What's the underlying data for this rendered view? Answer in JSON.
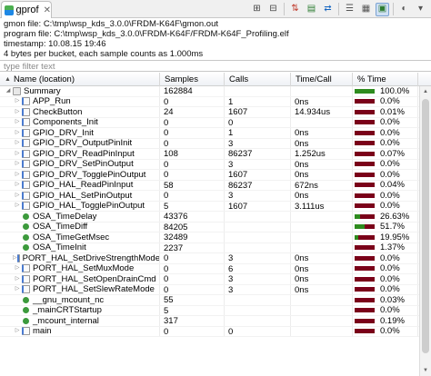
{
  "view_tab": {
    "label": "gprof",
    "close": "✕"
  },
  "toolbar": [
    {
      "name": "expand-all-icon",
      "glyph": "⊞",
      "color": "#444444",
      "active": false
    },
    {
      "name": "collapse-all-icon",
      "glyph": "⊟",
      "color": "#444444",
      "active": false
    },
    {
      "name": "sort-icon",
      "glyph": "⇅",
      "color": "#c0392b",
      "active": false
    },
    {
      "name": "export-csv-icon",
      "glyph": "▤",
      "color": "#2e7d32",
      "active": false
    },
    {
      "name": "switch-sample-time-icon",
      "glyph": "⇄",
      "color": "#1565c0",
      "active": false
    },
    {
      "name": "flat-view-icon",
      "glyph": "☰",
      "color": "#555555",
      "active": false
    },
    {
      "name": "tree-view-icon",
      "glyph": "▦",
      "color": "#555555",
      "active": false
    },
    {
      "name": "function-view-icon",
      "glyph": "▣",
      "color": "#2e7d32",
      "active": true
    },
    {
      "name": "chart-icon",
      "glyph": "◐",
      "color": "#555555",
      "active": false
    },
    {
      "name": "view-menu-icon",
      "glyph": "▾",
      "color": "#555555",
      "active": false
    }
  ],
  "info": {
    "gmon_file": "gmon file: C:\\tmp\\wsp_kds_3.0.0\\FRDM-K64F\\gmon.out",
    "program_file": "program file: C:\\tmp\\wsp_kds_3.0.0\\FRDM-K64F/FRDM-K64F_Profiling.elf",
    "timestamp": "timestamp: 10.08.15 19:46",
    "bucket_info": "4 bytes per bucket, each sample counts as 1.000ms"
  },
  "filter": {
    "placeholder": "type filter text",
    "value": ""
  },
  "columns": {
    "name": "Name (location)",
    "samples": "Samples",
    "calls": "Calls",
    "time_call": "Time/Call",
    "pct_time": "% Time"
  },
  "sort_indicator": "▲",
  "colors": {
    "bar_good": "#2e8b1e",
    "bar_bad": "#7a0019"
  },
  "rows": [
    {
      "level": 0,
      "kind": "summary",
      "expand": "◢",
      "name": "Summary",
      "samples": "162884",
      "calls": "",
      "time_call": "",
      "pct": "100.0%",
      "fill": 1.0
    },
    {
      "level": 1,
      "kind": "file",
      "expand": "▷",
      "name": "APP_Run",
      "samples": "0",
      "calls": "1",
      "time_call": "0ns",
      "pct": "0.0%",
      "fill": 0.0
    },
    {
      "level": 1,
      "kind": "file",
      "expand": "▷",
      "name": "CheckButton",
      "samples": "24",
      "calls": "1607",
      "time_call": "14.934us",
      "pct": "0.01%",
      "fill": 0.0
    },
    {
      "level": 1,
      "kind": "file",
      "expand": "▷",
      "name": "Components_Init",
      "samples": "0",
      "calls": "0",
      "time_call": "",
      "pct": "0.0%",
      "fill": 0.0
    },
    {
      "level": 1,
      "kind": "file",
      "expand": "▷",
      "name": "GPIO_DRV_Init",
      "samples": "0",
      "calls": "1",
      "time_call": "0ns",
      "pct": "0.0%",
      "fill": 0.0
    },
    {
      "level": 1,
      "kind": "file",
      "expand": "▷",
      "name": "GPIO_DRV_OutputPinInit",
      "samples": "0",
      "calls": "3",
      "time_call": "0ns",
      "pct": "0.0%",
      "fill": 0.0
    },
    {
      "level": 1,
      "kind": "file",
      "expand": "▷",
      "name": "GPIO_DRV_ReadPinInput",
      "samples": "108",
      "calls": "86237",
      "time_call": "1.252us",
      "pct": "0.07%",
      "fill": 0.0
    },
    {
      "level": 1,
      "kind": "file",
      "expand": "▷",
      "name": "GPIO_DRV_SetPinOutput",
      "samples": "0",
      "calls": "3",
      "time_call": "0ns",
      "pct": "0.0%",
      "fill": 0.0
    },
    {
      "level": 1,
      "kind": "file",
      "expand": "▷",
      "name": "GPIO_DRV_TogglePinOutput",
      "samples": "0",
      "calls": "1607",
      "time_call": "0ns",
      "pct": "0.0%",
      "fill": 0.0
    },
    {
      "level": 1,
      "kind": "file",
      "expand": "▷",
      "name": "GPIO_HAL_ReadPinInput",
      "samples": "58",
      "calls": "86237",
      "time_call": "672ns",
      "pct": "0.04%",
      "fill": 0.0
    },
    {
      "level": 1,
      "kind": "file",
      "expand": "▷",
      "name": "GPIO_HAL_SetPinOutput",
      "samples": "0",
      "calls": "3",
      "time_call": "0ns",
      "pct": "0.0%",
      "fill": 0.0
    },
    {
      "level": 1,
      "kind": "file",
      "expand": "▷",
      "name": "GPIO_HAL_TogglePinOutput",
      "samples": "5",
      "calls": "1607",
      "time_call": "3.111us",
      "pct": "0.0%",
      "fill": 0.0
    },
    {
      "level": 1,
      "kind": "func",
      "expand": "",
      "name": "OSA_TimeDelay",
      "samples": "43376",
      "calls": "",
      "time_call": "",
      "pct": "26.63%",
      "fill": 0.2663
    },
    {
      "level": 1,
      "kind": "func",
      "expand": "",
      "name": "OSA_TimeDiff",
      "samples": "84205",
      "calls": "",
      "time_call": "",
      "pct": "51.7%",
      "fill": 0.517
    },
    {
      "level": 1,
      "kind": "func",
      "expand": "",
      "name": "OSA_TimeGetMsec",
      "samples": "32489",
      "calls": "",
      "time_call": "",
      "pct": "19.95%",
      "fill": 0.1995
    },
    {
      "level": 1,
      "kind": "func",
      "expand": "",
      "name": "OSA_TimeInit",
      "samples": "2237",
      "calls": "",
      "time_call": "",
      "pct": "1.37%",
      "fill": 0.0137
    },
    {
      "level": 1,
      "kind": "file",
      "expand": "▷",
      "name": "PORT_HAL_SetDriveStrengthMode",
      "samples": "0",
      "calls": "3",
      "time_call": "0ns",
      "pct": "0.0%",
      "fill": 0.0
    },
    {
      "level": 1,
      "kind": "file",
      "expand": "▷",
      "name": "PORT_HAL_SetMuxMode",
      "samples": "0",
      "calls": "6",
      "time_call": "0ns",
      "pct": "0.0%",
      "fill": 0.0
    },
    {
      "level": 1,
      "kind": "file",
      "expand": "▷",
      "name": "PORT_HAL_SetOpenDrainCmd",
      "samples": "0",
      "calls": "3",
      "time_call": "0ns",
      "pct": "0.0%",
      "fill": 0.0
    },
    {
      "level": 1,
      "kind": "file",
      "expand": "▷",
      "name": "PORT_HAL_SetSlewRateMode",
      "samples": "0",
      "calls": "3",
      "time_call": "0ns",
      "pct": "0.0%",
      "fill": 0.0
    },
    {
      "level": 1,
      "kind": "func",
      "expand": "",
      "name": "__gnu_mcount_nc",
      "samples": "55",
      "calls": "",
      "time_call": "",
      "pct": "0.03%",
      "fill": 0.0003
    },
    {
      "level": 1,
      "kind": "func",
      "expand": "",
      "name": "_mainCRTStartup",
      "samples": "5",
      "calls": "",
      "time_call": "",
      "pct": "0.0%",
      "fill": 0.0
    },
    {
      "level": 1,
      "kind": "func",
      "expand": "",
      "name": "_mcount_internal",
      "samples": "317",
      "calls": "",
      "time_call": "",
      "pct": "0.19%",
      "fill": 0.0019
    },
    {
      "level": 1,
      "kind": "file",
      "expand": "▷",
      "name": "main",
      "samples": "0",
      "calls": "0",
      "time_call": "",
      "pct": "0.0%",
      "fill": 0.0
    }
  ]
}
